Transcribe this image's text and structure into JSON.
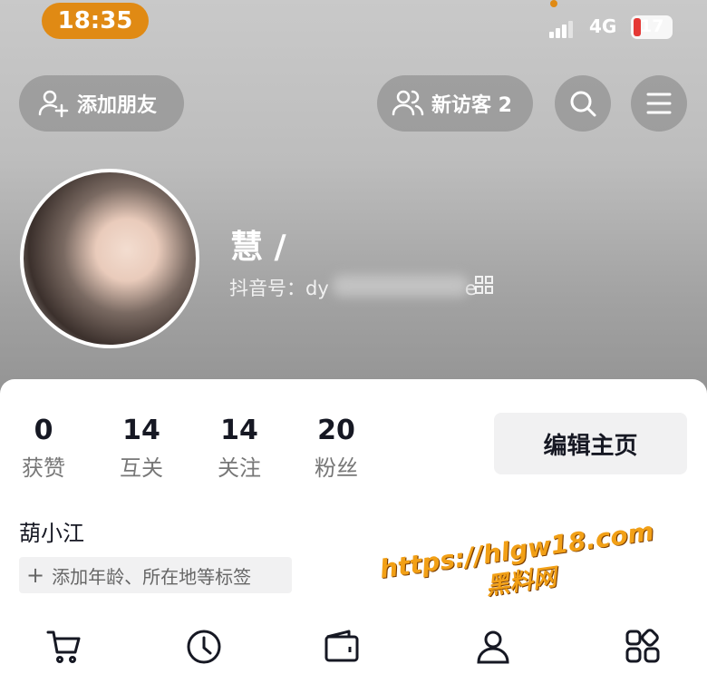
{
  "status_bar": {
    "time": "18:35",
    "network": "4G",
    "battery": "17"
  },
  "header": {
    "add_friend_label": "添加朋友",
    "visitors_label": "新访客 2"
  },
  "profile": {
    "nickname": "慧 /",
    "douyin_id_prefix": "抖音号：dy",
    "douyin_id_suffix": "e"
  },
  "stats": [
    {
      "value": "0",
      "label": "获赞"
    },
    {
      "value": "14",
      "label": "互关"
    },
    {
      "value": "14",
      "label": "关注"
    },
    {
      "value": "20",
      "label": "粉丝"
    }
  ],
  "edit_profile_label": "编辑主页",
  "bio_name": "葫小江",
  "add_tags_label": "添加年龄、所在地等标签",
  "watermark": {
    "url": "https://hlgw18.com",
    "site": "黑料网"
  },
  "bottom_icons": [
    "cart-icon",
    "clock-icon",
    "wallet-icon",
    "person-icon",
    "apps-icon"
  ],
  "colors": {
    "time_pill": "#e08a14",
    "battery_low": "#e53935",
    "watermark": "#f2a016"
  }
}
